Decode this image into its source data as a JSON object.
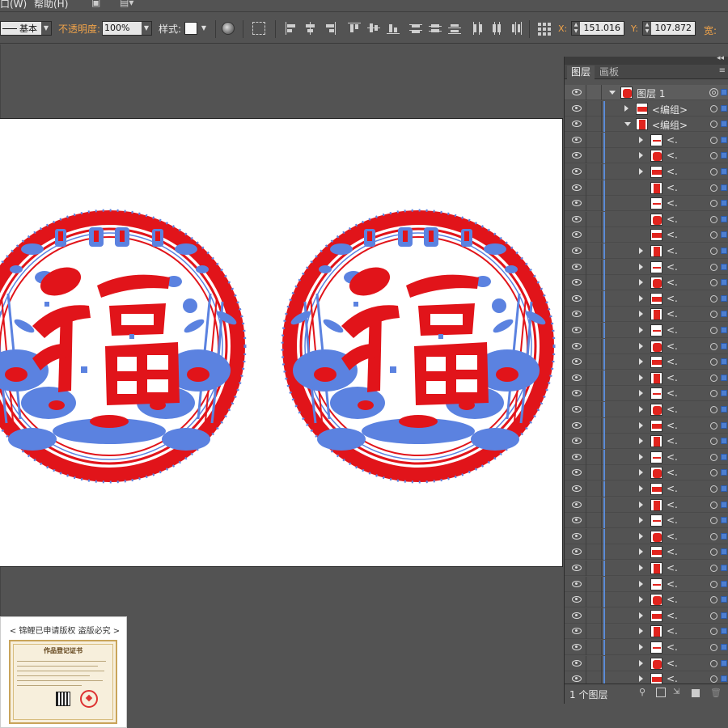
{
  "menubar": {
    "window_menu": "口(W)",
    "help_menu": "帮助(H)",
    "br_icon": "bridge-icon",
    "arrange_icon": "arrange-documents-icon"
  },
  "control_bar": {
    "stroke_profile": "基本",
    "opacity_label": "不透明度:",
    "opacity_value": "100%",
    "style_label": "样式:",
    "x_label": "X:",
    "x_value": "151.016",
    "y_label": "Y:",
    "y_value": "107.872",
    "w_label": "宽:"
  },
  "canvas": {
    "artwork_colors": {
      "red": "#e1141a",
      "blue_selection": "#5b82e0",
      "white": "#ffffff"
    },
    "medallion_glyph": "福"
  },
  "watermark": {
    "caption": "< 锦鲤已申请版权 盗版必究 >",
    "certificate_title": "作品登记证书"
  },
  "layers_panel": {
    "tabs": [
      "图层",
      "画板"
    ],
    "active_tab": "图层",
    "top_layer": "图层 1",
    "group_label": "<编组>",
    "truncated_label": "<...",
    "footer_count": "1 个图层",
    "rows": [
      {
        "name": "图层 1",
        "level": 0,
        "expanded": true
      },
      {
        "name": "<编组>",
        "level": 1,
        "expanded": false
      },
      {
        "name": "<编组>",
        "level": 1,
        "expanded": true
      },
      {
        "name": "<.",
        "level": 2,
        "expanded": false
      },
      {
        "name": "<.",
        "level": 2,
        "expanded": false
      },
      {
        "name": "<.",
        "level": 2,
        "expanded": false
      },
      {
        "name": "<.",
        "level": 2,
        "leaf": true
      },
      {
        "name": "<.",
        "level": 2,
        "leaf": true
      },
      {
        "name": "<.",
        "level": 2,
        "leaf": true
      },
      {
        "name": "<.",
        "level": 2,
        "leaf": true
      },
      {
        "name": "<.",
        "level": 2,
        "expanded": false
      },
      {
        "name": "<.",
        "level": 2,
        "expanded": false
      },
      {
        "name": "<.",
        "level": 2,
        "expanded": false
      },
      {
        "name": "<.",
        "level": 2,
        "expanded": false
      },
      {
        "name": "<.",
        "level": 2,
        "expanded": false
      },
      {
        "name": "<.",
        "level": 2,
        "expanded": false
      },
      {
        "name": "<.",
        "level": 2,
        "expanded": false
      },
      {
        "name": "<.",
        "level": 2,
        "expanded": false
      },
      {
        "name": "<.",
        "level": 2,
        "expanded": false
      },
      {
        "name": "<.",
        "level": 2,
        "expanded": false
      },
      {
        "name": "<.",
        "level": 2,
        "expanded": false
      },
      {
        "name": "<.",
        "level": 2,
        "expanded": false
      },
      {
        "name": "<.",
        "level": 2,
        "expanded": false
      },
      {
        "name": "<.",
        "level": 2,
        "expanded": false
      },
      {
        "name": "<.",
        "level": 2,
        "expanded": false
      },
      {
        "name": "<.",
        "level": 2,
        "expanded": false
      },
      {
        "name": "<.",
        "level": 2,
        "expanded": false
      },
      {
        "name": "<.",
        "level": 2,
        "expanded": false
      },
      {
        "name": "<.",
        "level": 2,
        "expanded": false
      },
      {
        "name": "<.",
        "level": 2,
        "expanded": false
      },
      {
        "name": "<.",
        "level": 2,
        "expanded": false
      },
      {
        "name": "<.",
        "level": 2,
        "expanded": false
      },
      {
        "name": "<.",
        "level": 2,
        "expanded": false
      },
      {
        "name": "<.",
        "level": 2,
        "expanded": false
      },
      {
        "name": "<.",
        "level": 2,
        "expanded": false
      },
      {
        "name": "<.",
        "level": 2,
        "expanded": false
      },
      {
        "name": "<.",
        "level": 2,
        "expanded": false
      },
      {
        "name": "<.",
        "level": 2,
        "expanded": false
      }
    ]
  }
}
